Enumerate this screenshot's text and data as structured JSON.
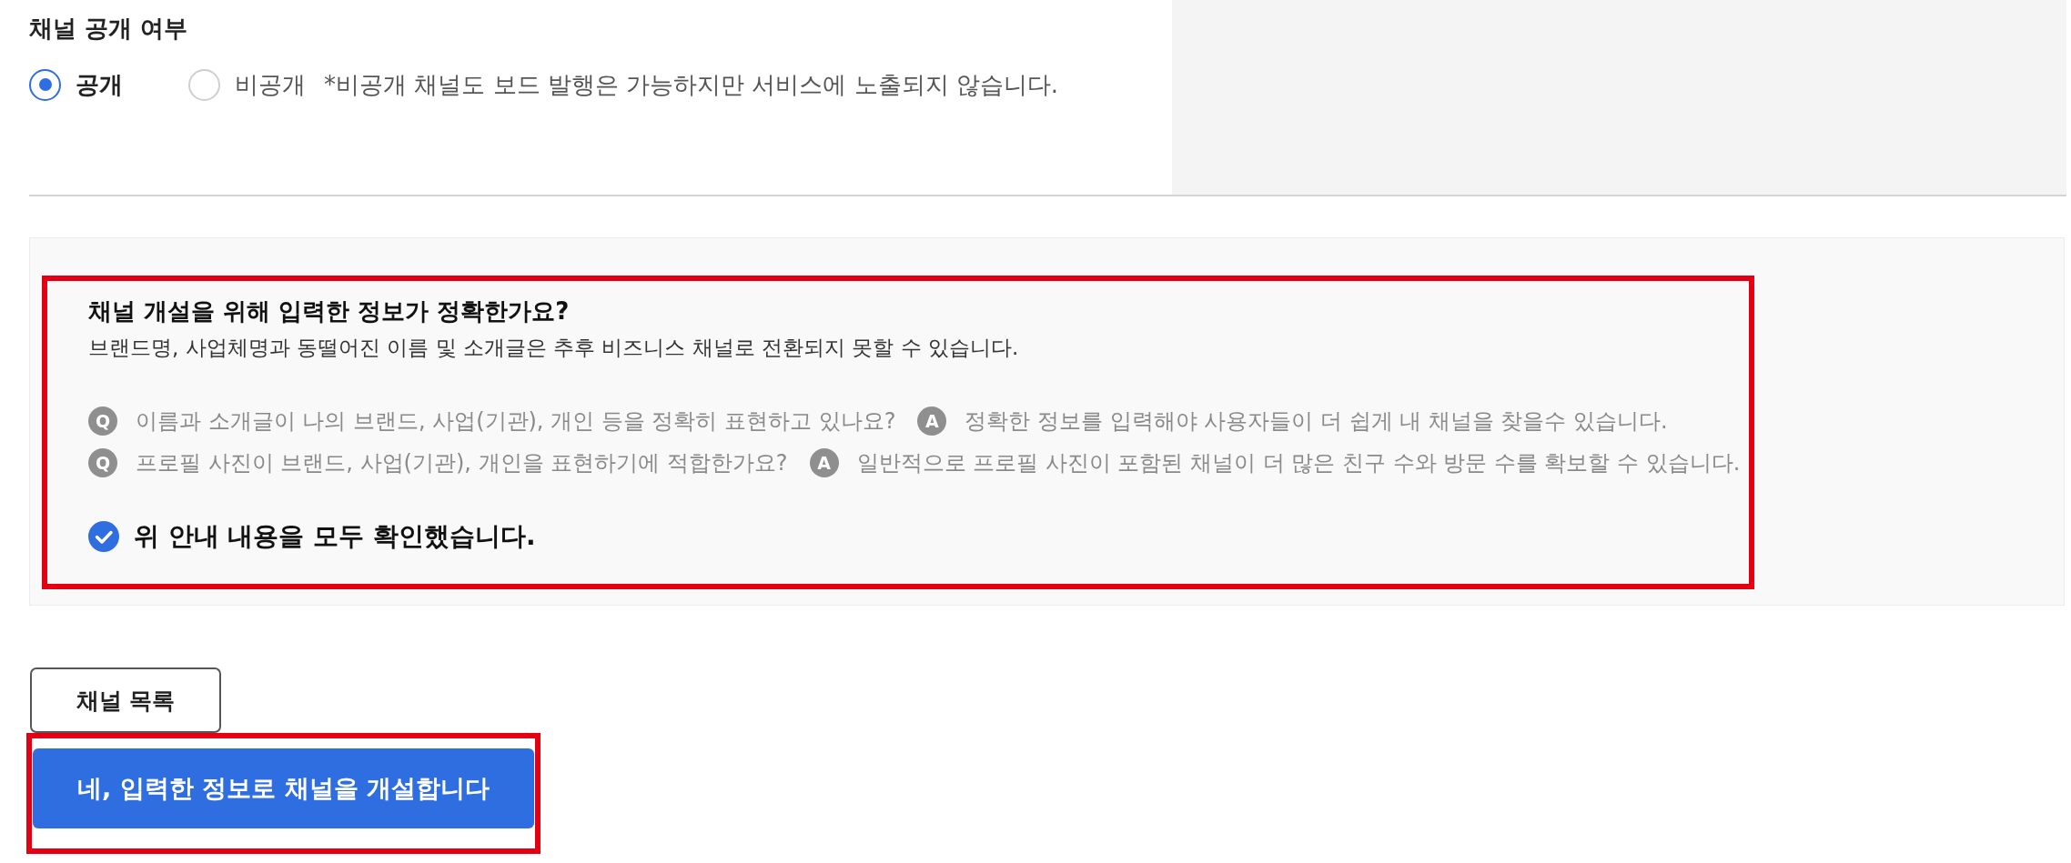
{
  "visibility": {
    "title": "채널 공개 여부",
    "options": [
      {
        "label": "공개",
        "selected": true
      },
      {
        "label": "비공개",
        "selected": false
      }
    ],
    "note": "*비공개 채널도 보드 발행은 가능하지만 서비스에 노출되지 않습니다."
  },
  "confirm_box": {
    "highlighted": true,
    "title": "채널 개설을 위해 입력한 정보가 정확한가요?",
    "description": "브랜드명, 사업체명과 동떨어진 이름 및 소개글은 추후 비즈니스 채널로 전환되지 못할 수 있습니다.",
    "faq": [
      {
        "q_badge": "Q",
        "question": "이름과 소개글이 나의 브랜드, 사업(기관), 개인 등을 정확히 표현하고 있나요?",
        "a_badge": "A",
        "answer": "정확한 정보를 입력해야 사용자들이 더 쉽게 내 채널을 찾을수 있습니다."
      },
      {
        "q_badge": "Q",
        "question": "프로필 사진이 브랜드, 사업(기관), 개인을 표현하기에 적합한가요?",
        "a_badge": "A",
        "answer": "일반적으로 프로필 사진이 포함된 채널이 더 많은 친구 수와 방문 수를 확보할 수 있습니다."
      }
    ],
    "acknowledge": {
      "label": "위 안내 내용을 모두 확인했습니다.",
      "checked": true
    }
  },
  "buttons": [
    {
      "label": "채널 목록",
      "kind": "outline",
      "highlighted": false
    },
    {
      "label": "네, 입력한 정보로 채널을 개설합니다",
      "kind": "primary",
      "highlighted": true
    }
  ]
}
